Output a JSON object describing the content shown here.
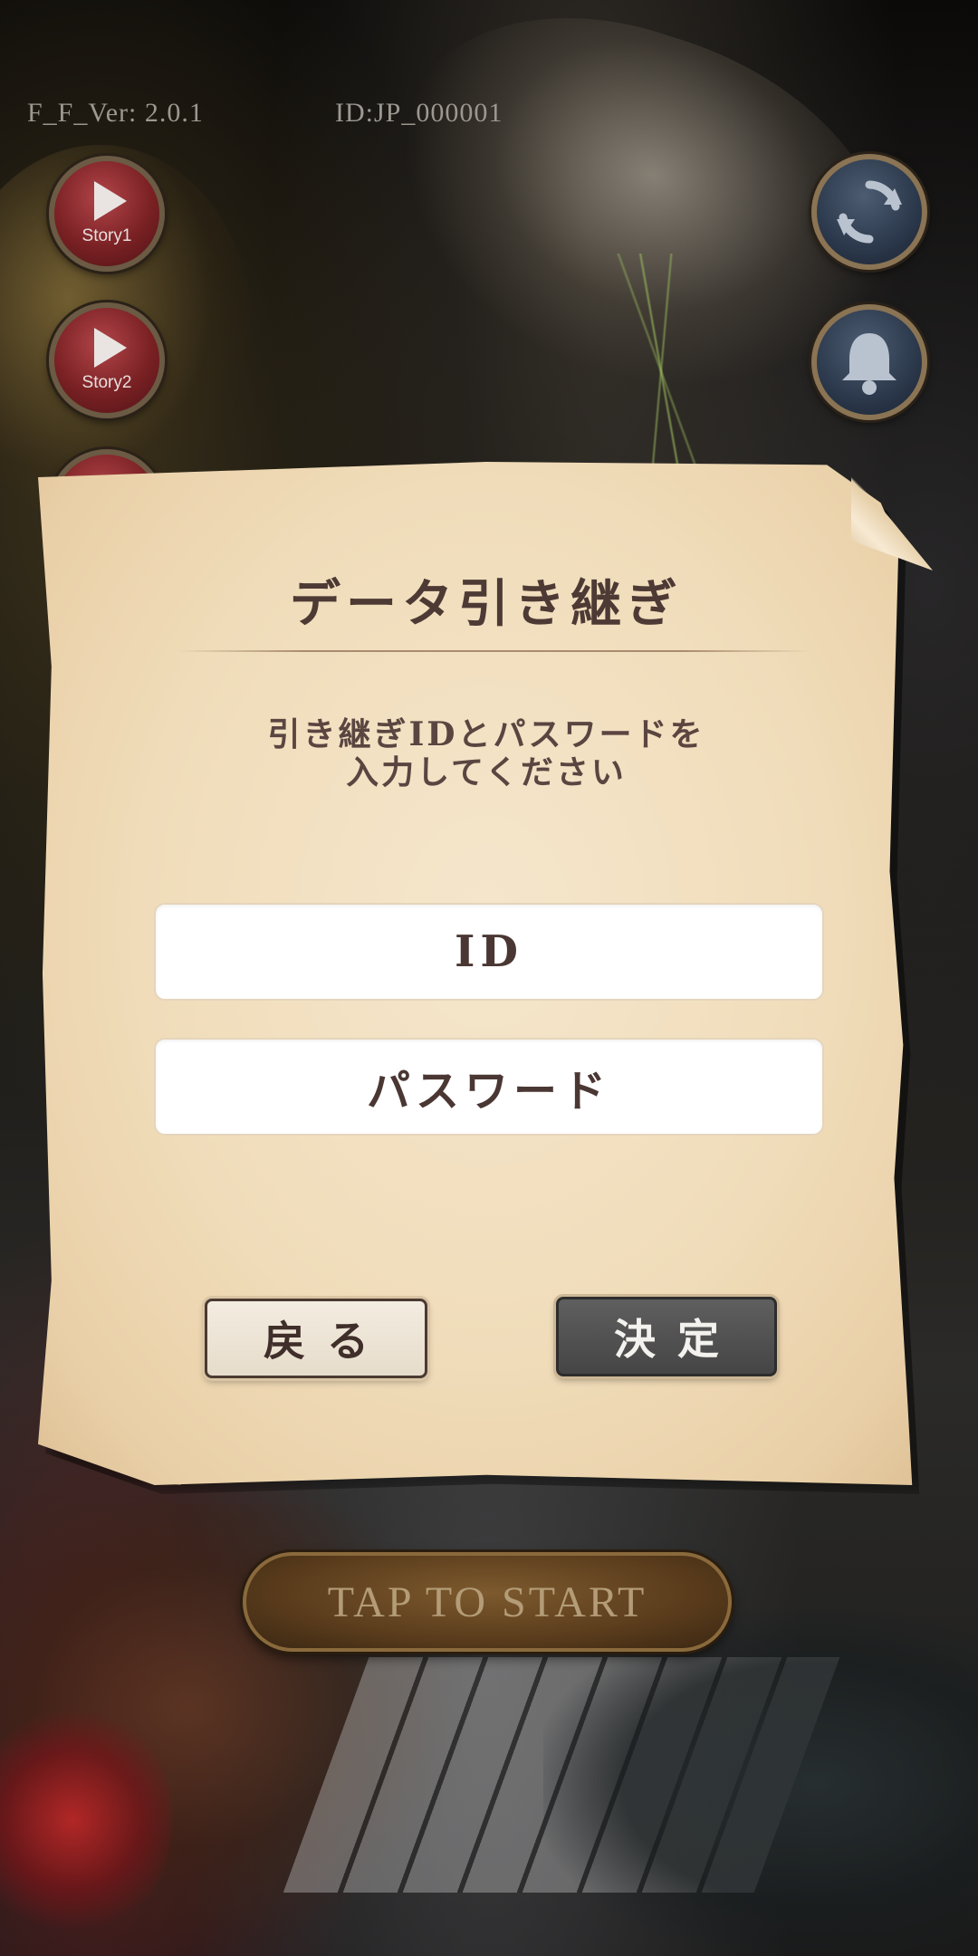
{
  "header": {
    "version": "F_F_Ver: 2.0.1",
    "user_id": "ID:JP_000001"
  },
  "side_buttons": {
    "story1_label": "Story1",
    "story2_label": "Story2"
  },
  "icons": {
    "refresh": "refresh-icon",
    "bell": "bell-icon",
    "play": "play-icon"
  },
  "dialog": {
    "title": "データ引き継ぎ",
    "instruction_line1": "引き継ぎIDとパスワードを",
    "instruction_line2": "入力してください",
    "id_placeholder": "ID",
    "password_placeholder": "パスワード",
    "back_label": "戻る",
    "confirm_label": "決定"
  },
  "start": {
    "label": "TAP TO START"
  },
  "colors": {
    "parchment": "#f0dcb9",
    "title_text": "#4d3a35",
    "confirm_button": "#4f4f4f",
    "story_button": "#7a2124",
    "util_button": "#2b384b"
  }
}
